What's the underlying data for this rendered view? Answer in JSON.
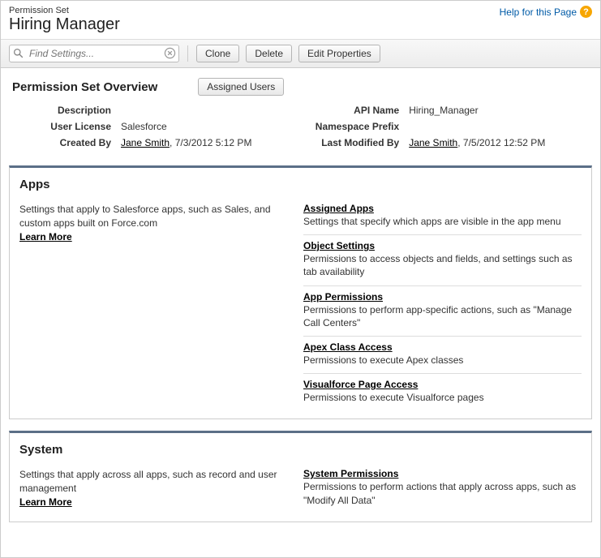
{
  "header": {
    "breadcrumb": "Permission Set",
    "title": "Hiring Manager",
    "help_text": "Help for this Page"
  },
  "search": {
    "placeholder": "Find Settings..."
  },
  "actions": {
    "clone": "Clone",
    "delete": "Delete",
    "edit": "Edit Properties"
  },
  "overview": {
    "title": "Permission Set Overview",
    "assigned_users_btn": "Assigned Users",
    "labels": {
      "description": "Description",
      "user_license": "User License",
      "created_by": "Created By",
      "api_name": "API Name",
      "namespace_prefix": "Namespace Prefix",
      "last_modified_by": "Last Modified By"
    },
    "values": {
      "description": "",
      "user_license": "Salesforce",
      "created_by_user": "Jane Smith",
      "created_by_date": ", 7/3/2012 5:12 PM",
      "api_name": "Hiring_Manager",
      "namespace_prefix": "",
      "modified_by_user": "Jane Smith",
      "modified_by_date": ", 7/5/2012 12:52 PM"
    }
  },
  "apps": {
    "title": "Apps",
    "desc": "Settings that apply to Salesforce apps, such as Sales, and custom apps built on Force.com",
    "learn_more": "Learn More",
    "links": [
      {
        "title": "Assigned Apps",
        "desc": "Settings that specify which apps are visible in the app menu"
      },
      {
        "title": "Object Settings",
        "desc": "Permissions to access objects and fields, and settings such as tab availability"
      },
      {
        "title": "App Permissions",
        "desc": "Permissions to perform app-specific actions, such as \"Manage Call Centers\""
      },
      {
        "title": "Apex Class Access",
        "desc": "Permissions to execute Apex classes"
      },
      {
        "title": "Visualforce Page Access",
        "desc": "Permissions to execute Visualforce pages"
      }
    ]
  },
  "system": {
    "title": "System",
    "desc": "Settings that apply across all apps, such as record and user management",
    "learn_more": "Learn More",
    "links": [
      {
        "title": "System Permissions",
        "desc": "Permissions to perform actions that apply across apps, such as \"Modify All Data\""
      }
    ]
  }
}
